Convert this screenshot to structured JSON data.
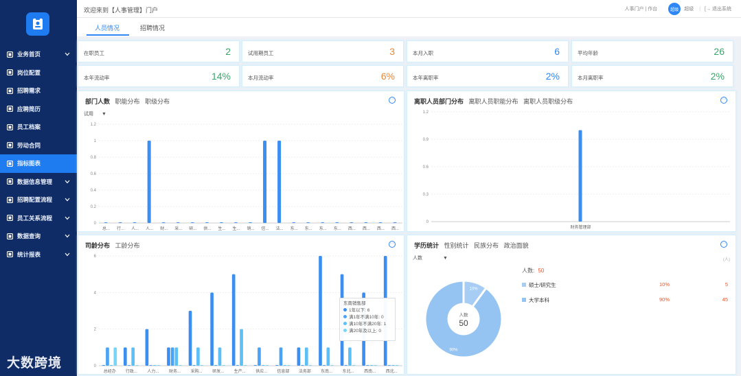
{
  "sidebar": {
    "items": [
      {
        "label": "业务首页",
        "icon": "cube-icon",
        "chevron": true,
        "active": false
      },
      {
        "label": "岗位配置",
        "icon": "id-card-icon",
        "chevron": false,
        "active": false
      },
      {
        "label": "招聘需求",
        "icon": "clipboard-icon",
        "chevron": false,
        "active": false
      },
      {
        "label": "应聘简历",
        "icon": "user-icon",
        "chevron": false,
        "active": false
      },
      {
        "label": "员工档案",
        "icon": "folder-icon",
        "chevron": false,
        "active": false
      },
      {
        "label": "劳动合同",
        "icon": "contract-icon",
        "chevron": false,
        "active": false
      },
      {
        "label": "指标图表",
        "icon": "chart-icon",
        "chevron": false,
        "active": true
      },
      {
        "label": "数据信息管理",
        "icon": "users-icon",
        "chevron": true,
        "active": false
      },
      {
        "label": "招聘配置流程",
        "icon": "flow-icon",
        "chevron": true,
        "active": false
      },
      {
        "label": "员工关系流程",
        "icon": "diamond-icon",
        "chevron": true,
        "active": false
      },
      {
        "label": "数据查询",
        "icon": "search-doc-icon",
        "chevron": true,
        "active": false
      },
      {
        "label": "统计报表",
        "icon": "report-icon",
        "chevron": true,
        "active": false
      }
    ]
  },
  "header": {
    "welcome": "欢迎来到【人事管理】门户",
    "links": "人事门户 | 作台",
    "avatar_text": "超级",
    "user": "超级",
    "logout": "退出系统"
  },
  "tabs": [
    {
      "label": "人员情况",
      "active": true
    },
    {
      "label": "招聘情况",
      "active": false
    }
  ],
  "stats": [
    {
      "label": "在职员工",
      "value": "2",
      "color": "#3aa56b"
    },
    {
      "label": "试用期员工",
      "value": "3",
      "color": "#e8893a"
    },
    {
      "label": "本月入职",
      "value": "6",
      "color": "#2f86f6"
    },
    {
      "label": "平均年龄",
      "value": "26",
      "color": "#3aa56b"
    },
    {
      "label": "本年流动率",
      "value": "14%",
      "color": "#3aa56b"
    },
    {
      "label": "本月流动率",
      "value": "6%",
      "color": "#e8893a"
    },
    {
      "label": "本年离职率",
      "value": "2%",
      "color": "#2f86f6"
    },
    {
      "label": "本月离职率",
      "value": "2%",
      "color": "#3aa56b"
    }
  ],
  "panels": {
    "dept": {
      "tabs": [
        "部门人数",
        "职能分布",
        "职级分布"
      ],
      "selector": "试用",
      "more": "···"
    },
    "resign": {
      "tabs": [
        "离职人员部门分布",
        "离职人员职能分布",
        "离职人员职级分布"
      ],
      "more": "···"
    },
    "tenure": {
      "tabs": [
        "司龄分布",
        "工龄分布"
      ],
      "more": "···"
    },
    "edu": {
      "tabs": [
        "学历统计",
        "性别统计",
        "民族分布",
        "政治面貌"
      ],
      "selector": "人数",
      "more": "···",
      "unit": "(人)"
    }
  },
  "edu_summary": {
    "label": "人数:",
    "total": "50"
  },
  "edu_rows": [
    {
      "label": "硕士/研究生",
      "pct": "10%",
      "count": "5"
    },
    {
      "label": "大学本科",
      "pct": "90%",
      "count": "45"
    }
  ],
  "tooltip": {
    "title": "东南销售部",
    "rows": [
      "1年以下: 6",
      "满1年不满10年: 0",
      "满10年不满20年: 1",
      "满20年及以上: 0"
    ]
  },
  "watermark": "大数跨境",
  "chart_data": [
    {
      "type": "bar",
      "title": "部门人数",
      "categories": [
        "总...",
        "行...",
        "人...",
        "人...",
        "财...",
        "采...",
        "研...",
        "供...",
        "生...",
        "生...",
        "销...",
        "信...",
        "法...",
        "东...",
        "东...",
        "东...",
        "东...",
        "西...",
        "西...",
        "西...",
        "西..."
      ],
      "values": [
        0,
        0,
        0,
        1,
        0,
        0,
        0,
        0,
        0,
        0,
        0,
        1,
        1,
        0,
        0,
        0,
        0,
        0,
        0,
        0,
        0
      ],
      "ylim": [
        0,
        1.2
      ],
      "yticks": [
        "0",
        "0.2",
        "0.4",
        "0.6",
        "0.8",
        "1",
        "1.2"
      ],
      "color": "#3c8ff0"
    },
    {
      "type": "bar",
      "title": "离职人员部门分布",
      "categories": [
        "财务管理部"
      ],
      "values": [
        1
      ],
      "ylim": [
        0,
        1.2
      ],
      "yticks": [
        "0",
        "0.3",
        "0.6",
        "0.9",
        "1.2"
      ],
      "color": "#3c8ff0"
    },
    {
      "type": "bar",
      "title": "司龄分布",
      "categories": [
        "总经办",
        "行政...",
        "人力...",
        "财务...",
        "采购...",
        "研发...",
        "生产...",
        "供应...",
        "信息部",
        "法务部",
        "东南...",
        "东北...",
        "西南...",
        "西北..."
      ],
      "series": [
        {
          "name": "1年以下",
          "values": [
            0,
            1,
            2,
            1,
            3,
            4,
            5,
            0,
            0,
            1,
            6,
            5,
            4,
            6
          ]
        },
        {
          "name": "满1年不满10年",
          "values": [
            1,
            0,
            0,
            1,
            0,
            0,
            0,
            1,
            1,
            0,
            0,
            0,
            0,
            0
          ]
        },
        {
          "name": "满10年不满20年",
          "values": [
            0,
            1,
            0,
            1,
            1,
            1,
            2,
            0,
            0,
            1,
            1,
            1,
            0,
            0
          ]
        },
        {
          "name": "满20年及以上",
          "values": [
            1,
            0,
            0,
            0,
            0,
            0,
            0,
            0,
            0,
            0,
            0,
            0,
            0,
            0
          ]
        }
      ],
      "ylim": [
        0,
        6
      ],
      "yticks": [
        "0",
        "2",
        "4",
        "6"
      ],
      "colors": [
        "#3c8ff0",
        "#4aa3f5",
        "#5cc0f7",
        "#78d4fa"
      ]
    },
    {
      "type": "pie",
      "title": "学历统计",
      "labels": [
        "硕士/研究生",
        "大学本科"
      ],
      "values": [
        5,
        45
      ],
      "slice_labels": [
        "10%",
        "90%"
      ],
      "center_label": "人数",
      "center_value": "50",
      "colors": [
        "#a7cdf5",
        "#96c4f2"
      ]
    }
  ]
}
